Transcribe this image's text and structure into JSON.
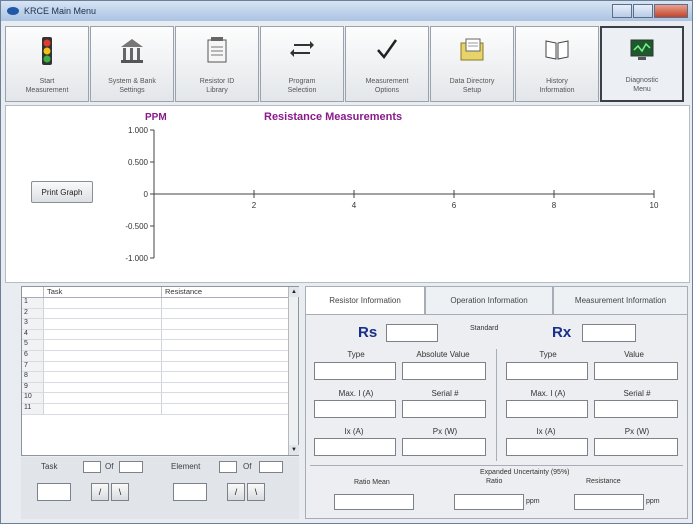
{
  "window": {
    "title": "KRCE Main Menu"
  },
  "toolbar": {
    "buttons": [
      {
        "label": "Start\nMeasurement",
        "icon": "traffic-light-icon"
      },
      {
        "label": "System & Bank\nSettings",
        "icon": "bank-settings-icon"
      },
      {
        "label": "Resistor ID\nLibrary",
        "icon": "notepad-icon"
      },
      {
        "label": "Program\nSelection",
        "icon": "program-arrows-icon"
      },
      {
        "label": "Measurement\nOptions",
        "icon": "checkmark-icon"
      },
      {
        "label": "Data Directory\nSetup",
        "icon": "folder-icon"
      },
      {
        "label": "History\nInformation",
        "icon": "book-icon"
      },
      {
        "label": "Diagnostic\nMenu",
        "icon": "monitor-icon"
      }
    ]
  },
  "chart_data": {
    "type": "line",
    "title": "Resistance Measurements",
    "ylabel": "PPM",
    "xlabel": "",
    "ylim": [
      -1.0,
      1.0
    ],
    "xlim": [
      0,
      10
    ],
    "y_ticks": [
      "1.000",
      "0.500",
      "0",
      "-0.500",
      "-1.000"
    ],
    "x_ticks": [
      "2",
      "4",
      "6",
      "8",
      "10"
    ],
    "series": []
  },
  "print_graph": {
    "label": "Print Graph"
  },
  "grid": {
    "headers": {
      "task": "Task",
      "resistance": "Resistance"
    },
    "rows": [
      "1",
      "2",
      "3",
      "4",
      "5",
      "6",
      "7",
      "8",
      "9",
      "10",
      "11"
    ]
  },
  "bottom": {
    "task_label": "Task",
    "of1": "Of",
    "element_label": "Element",
    "of2": "Of"
  },
  "tabs": {
    "resistor": "Resistor Information",
    "operation": "Operation Information",
    "measurement": "Measurement Information"
  },
  "resistor": {
    "rs_label": "Rs",
    "standard_label": "Standard",
    "rx_label": "Rx",
    "type_label": "Type",
    "abs_value_label": "Absolute Value",
    "value_label": "Value",
    "max_i_label": "Max. I (A)",
    "serial_label": "Serial #",
    "ix_label": "Ix (A)",
    "px_label": "Px (W)",
    "expanded_uncertainty": "Expanded Uncertainty (95%)",
    "ratio_mean_label": "Ratio Mean",
    "ratio_label": "Ratio",
    "resistance_label": "Resistance",
    "ppm1": "ppm",
    "ppm2": "ppm"
  }
}
